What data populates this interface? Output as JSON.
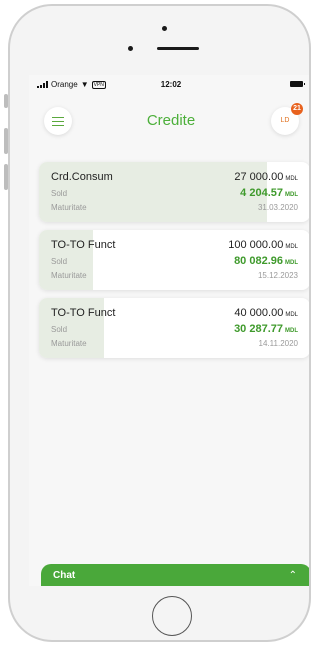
{
  "status": {
    "carrier": "Orange",
    "vpn": "VPN",
    "time": "12:02"
  },
  "header": {
    "title": "Credite",
    "avatar_initials": "LD",
    "notifications_count": "21"
  },
  "labels": {
    "balance": "Sold",
    "maturity": "Maturitate"
  },
  "credits": [
    {
      "name": "Crd.Consum",
      "amount": "27 000.00",
      "currency": "MDL",
      "balance": "4 204.57",
      "maturity": "31.03.2020",
      "repaid_fraction": 0.84
    },
    {
      "name": "TO-TO Funct",
      "amount": "100 000.00",
      "currency": "MDL",
      "balance": "80 082.96",
      "maturity": "15.12.2023",
      "repaid_fraction": 0.2
    },
    {
      "name": "TO-TO Funct",
      "amount": "40 000.00",
      "currency": "MDL",
      "balance": "30 287.77",
      "maturity": "14.11.2020",
      "repaid_fraction": 0.24
    }
  ],
  "chat": {
    "label": "Chat",
    "icon": "chevron-up-icon"
  },
  "colors": {
    "brand_green": "#4caf3a",
    "badge_orange": "#e8621e"
  }
}
